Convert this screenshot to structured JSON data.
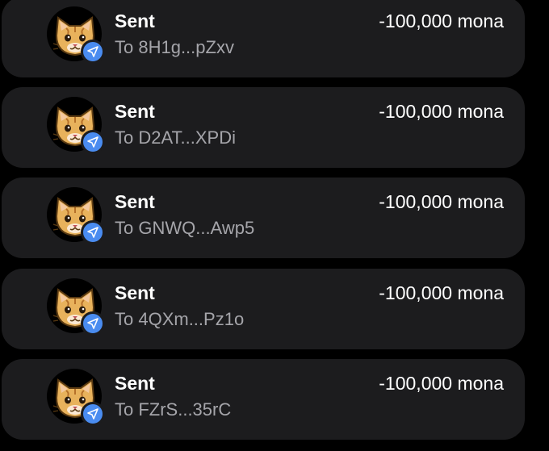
{
  "transactions": [
    {
      "title": "Sent",
      "recipient": "To 8H1g...pZxv",
      "amount": "-100,000 mona"
    },
    {
      "title": "Sent",
      "recipient": "To D2AT...XPDi",
      "amount": "-100,000 mona"
    },
    {
      "title": "Sent",
      "recipient": "To GNWQ...Awp5",
      "amount": "-100,000 mona"
    },
    {
      "title": "Sent",
      "recipient": "To 4QXm...Pz1o",
      "amount": "-100,000 mona"
    },
    {
      "title": "Sent",
      "recipient": "To FZrS...35rC",
      "amount": "-100,000 mona"
    }
  ],
  "icons": {
    "avatar": "cat-token-icon",
    "badge": "send-arrow-icon"
  },
  "colors": {
    "background": "#000000",
    "card": "#1c1c1e",
    "badge": "#4a8cf0",
    "secondary_text": "#a5a5aa"
  }
}
